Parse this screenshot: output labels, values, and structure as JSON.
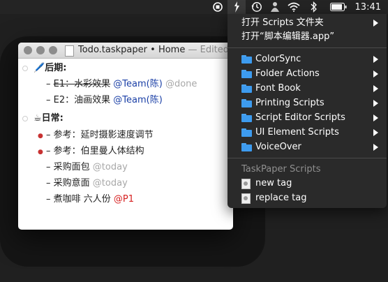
{
  "menubar": {
    "clock": "13:41",
    "icons": [
      "stop-record-icon",
      "script-menu-icon",
      "time-machine-icon",
      "user-icon",
      "wifi-icon",
      "bluetooth-icon",
      "battery-icon"
    ]
  },
  "window": {
    "filename": "Todo.taskpaper",
    "separator": "•",
    "location": "Home",
    "status": "— Edited"
  },
  "document": {
    "project1": {
      "emoji": "🖊️",
      "title": "后期:"
    },
    "task1": {
      "dash": "–",
      "text": "E1：水彩效果",
      "tag1": "@Team(陈)",
      "tag2": "@done"
    },
    "task2": {
      "dash": "–",
      "text": "E2：油画效果",
      "tag1": "@Team(陈)"
    },
    "project2": {
      "emoji": "☕",
      "title": "日常:"
    },
    "task3": {
      "bullet": "●",
      "dash": "–",
      "text": "参考：延时摄影速度调节"
    },
    "task4": {
      "bullet": "●",
      "dash": "–",
      "text": "参考：伯里曼人体结构"
    },
    "task5": {
      "dash": "–",
      "text": "采购面包",
      "tag": "@today"
    },
    "task6": {
      "dash": "–",
      "text": "采购意面",
      "tag": "@today"
    },
    "task7": {
      "dash": "–",
      "text": "煮咖啡 六人份",
      "tag": "@P1"
    }
  },
  "menu": {
    "open_folder": "打开 Scripts 文件夹",
    "open_editor": "打开“脚本编辑器.app”",
    "folders": [
      "ColorSync",
      "Folder Actions",
      "Font Book",
      "Printing Scripts",
      "Script Editor Scripts",
      "UI Element Scripts",
      "VoiceOver"
    ],
    "section_header": "TaskPaper Scripts",
    "scripts": [
      "new tag",
      "replace tag"
    ]
  },
  "colors": {
    "tag_team": "#1a3fa6",
    "tag_gray": "#a8a8a8",
    "tag_priority": "#d62020",
    "folder_blue": "#3d9bef"
  }
}
